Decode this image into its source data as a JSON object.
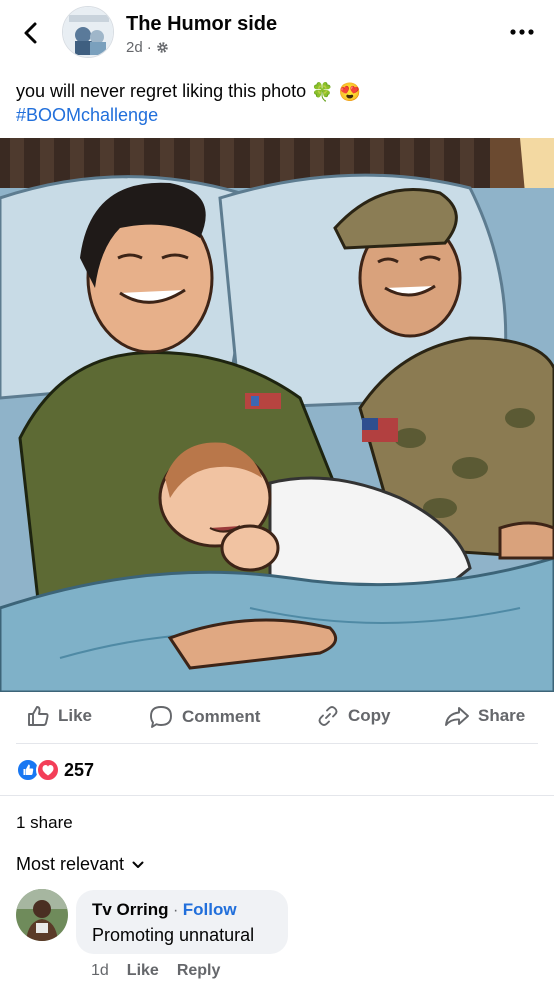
{
  "header": {
    "page_name": "The Humor side",
    "time": "2d",
    "separator": "·",
    "back_icon": "chevron-left-icon",
    "more_icon": "more-horizontal-icon",
    "privacy_icon": "gear-icon"
  },
  "post": {
    "caption": "you will never regret liking this photo",
    "emojis": [
      "🍀",
      "😍"
    ],
    "hashtag": "#BOOMchallenge",
    "image_description": ""
  },
  "actions": {
    "like": "Like",
    "comment": "Comment",
    "copy": "Copy",
    "share": "Share"
  },
  "stats": {
    "reaction_count": "257",
    "shares": "1 share"
  },
  "comments": {
    "sort_label": "Most relevant",
    "items": [
      {
        "author": "Tv Orring",
        "follow": "Follow",
        "text": "Promoting unnatural",
        "time": "1d",
        "like": "Like",
        "reply": "Reply"
      }
    ]
  },
  "colors": {
    "link": "#216fdb",
    "muted": "#65676b",
    "like_blue": "#1877f2",
    "love_red": "#f33e58",
    "bubble": "#f0f2f5"
  }
}
